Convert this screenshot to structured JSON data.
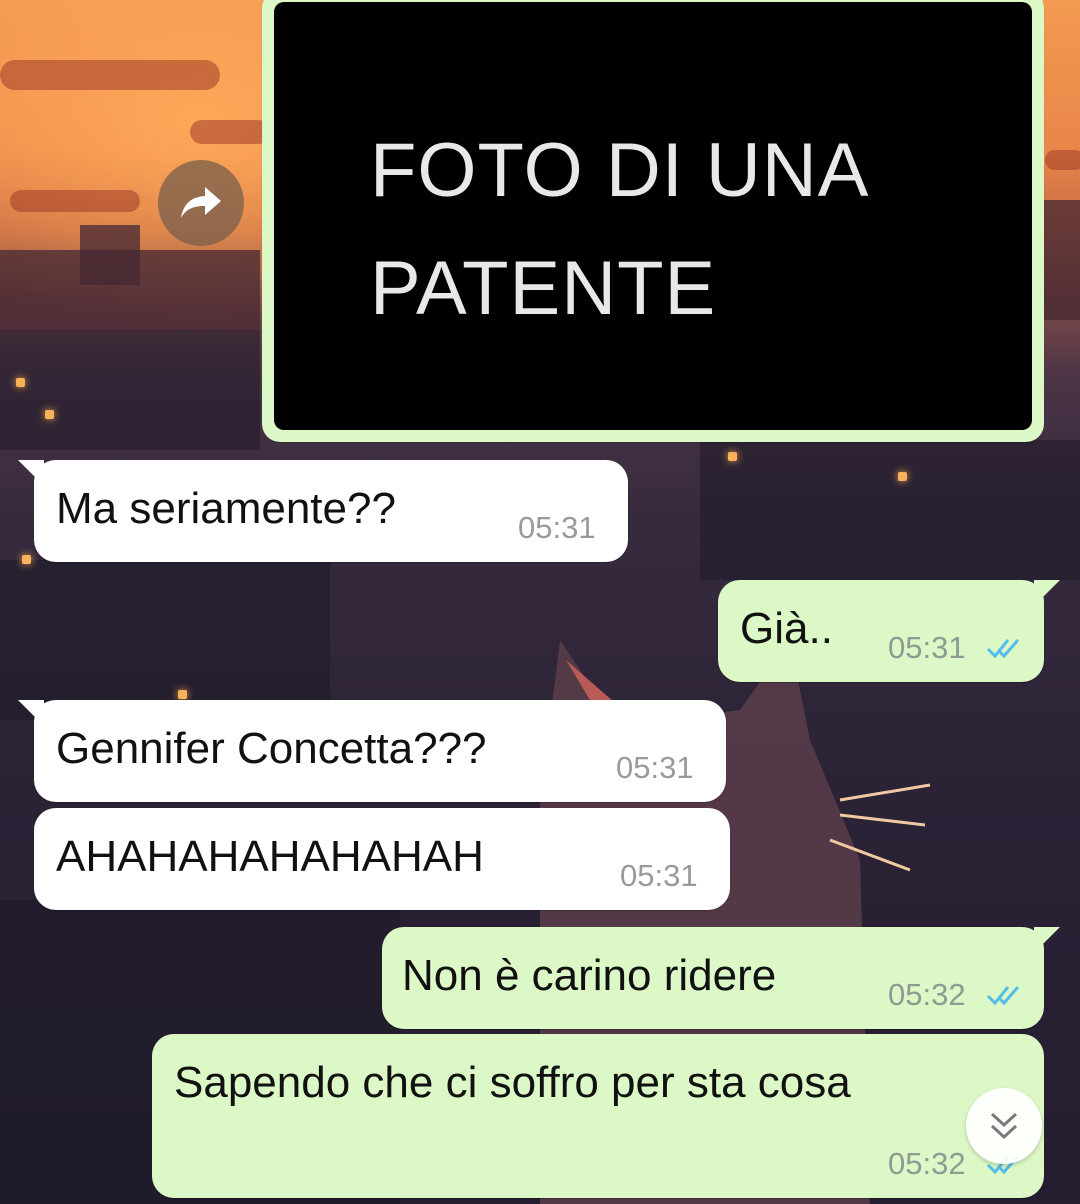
{
  "image_message": {
    "photo_text": "FOTO DI UNA\nPATENTE"
  },
  "messages": [
    {
      "text": "Ma seriamente??",
      "time": "05:31",
      "direction": "in"
    },
    {
      "text": "Già..",
      "time": "05:31",
      "direction": "out",
      "status": "read"
    },
    {
      "text": "Gennifer Concetta???",
      "time": "05:31",
      "direction": "in"
    },
    {
      "text": "AHAHAHAHAHAHAH",
      "time": "05:31",
      "direction": "in"
    },
    {
      "text": "Non è carino ridere",
      "time": "05:32",
      "direction": "out",
      "status": "read"
    },
    {
      "text": "Sapendo che ci soffro per sta cosa",
      "time": "05:32",
      "direction": "out",
      "status": "read"
    }
  ],
  "colors": {
    "incoming_bubble": "#ffffff",
    "outgoing_bubble": "#dcf8c6",
    "read_ticks": "#53bdeb"
  },
  "icons": {
    "forward": "forward-arrow-icon",
    "read_status": "double-check-icon",
    "scroll_down": "double-chevron-down-icon"
  }
}
